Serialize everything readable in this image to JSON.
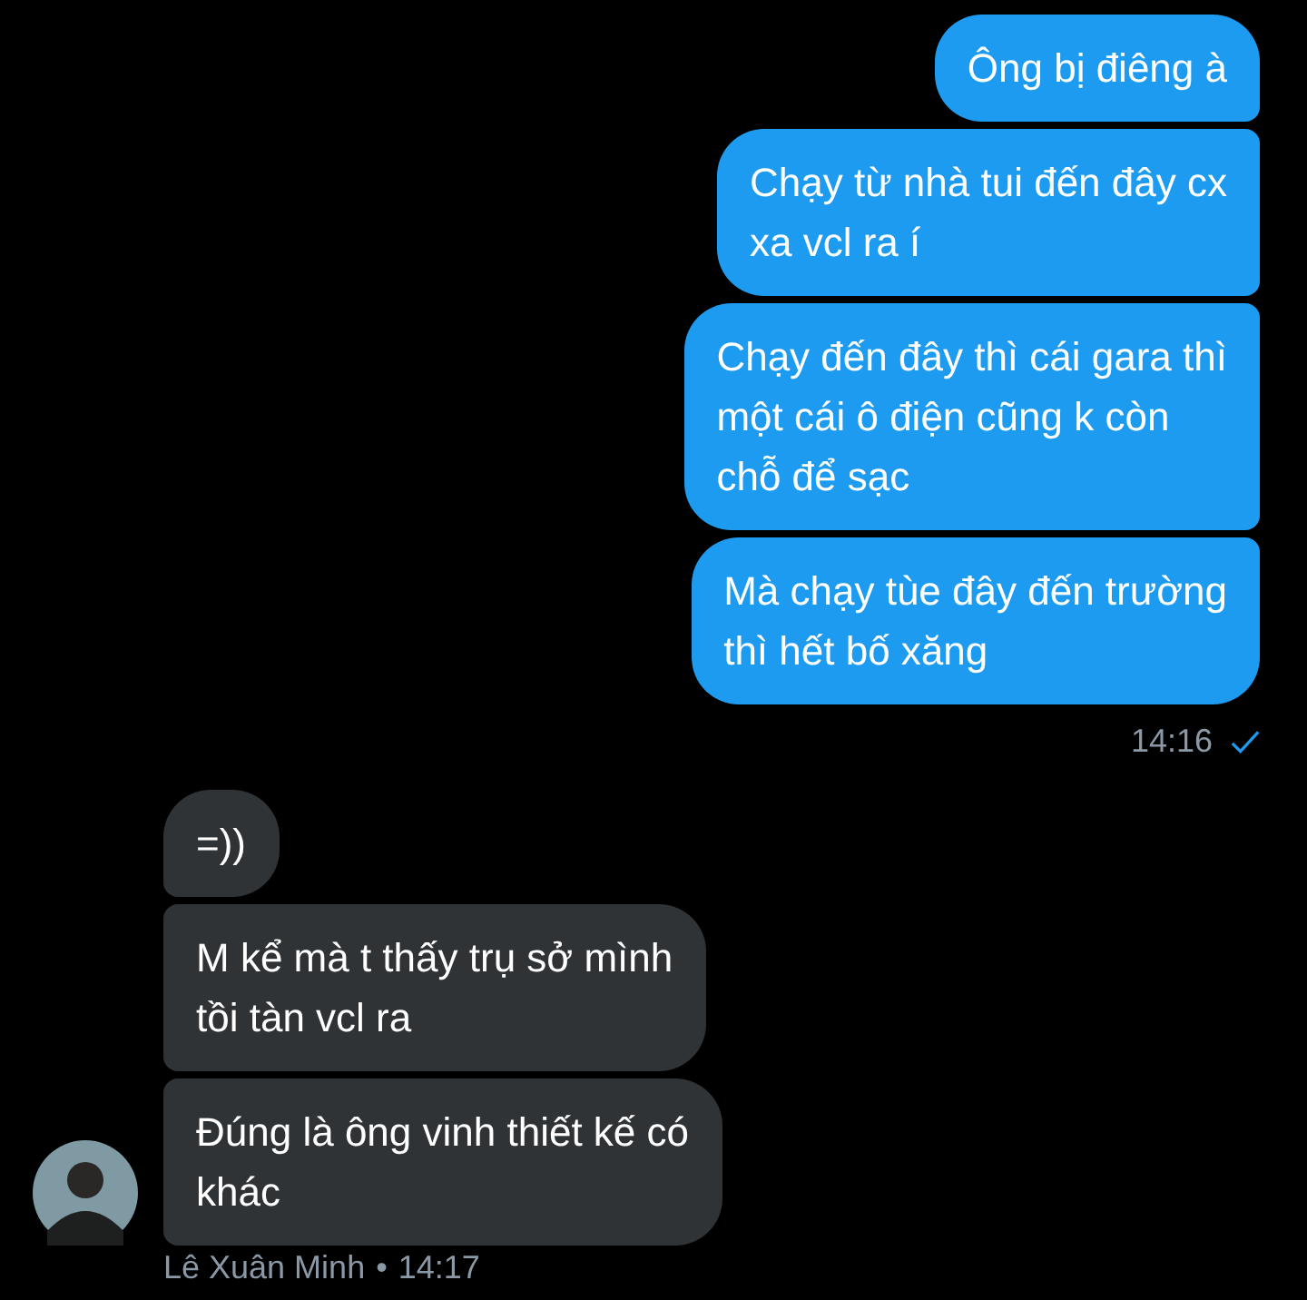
{
  "conversation": [
    {
      "kind": "outgoing",
      "messages": [
        "Ông bị điêng à",
        "Chạy từ nhà tui đến đây cx\nxa vcl ra í",
        "Chạy đến đây thì cái gara thì\nmột cái ô điện cũng k còn\nchỗ để sạc",
        "Mà chạy tùe đây đến trường\nthì hết bố xăng"
      ],
      "time": "14:16",
      "read": true
    },
    {
      "kind": "incoming",
      "messages": [
        "=))",
        "M kể mà t thấy trụ sở mình\ntồi tàn vcl ra",
        "Đúng là ông vinh thiết kế có\nkhác"
      ],
      "name": "Lê Xuân Minh",
      "separator": "•",
      "time": "14:17"
    }
  ]
}
